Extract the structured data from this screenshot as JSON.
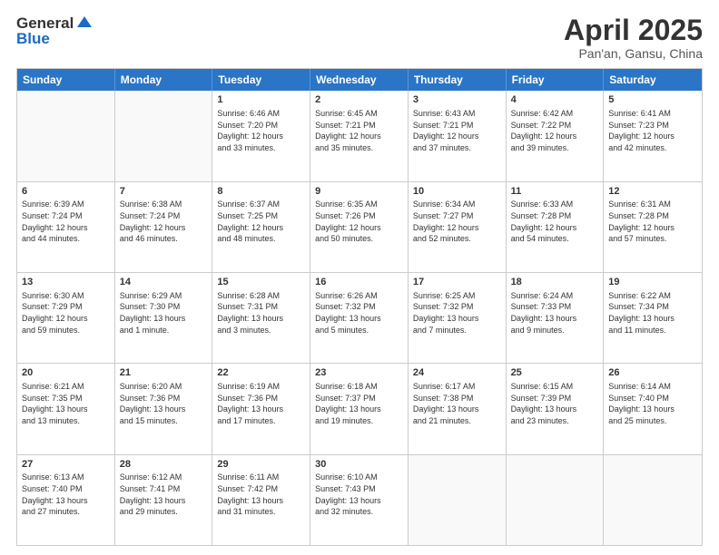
{
  "header": {
    "logo_general": "General",
    "logo_blue": "Blue",
    "title": "April 2025",
    "subtitle": "Pan'an, Gansu, China"
  },
  "calendar": {
    "days": [
      "Sunday",
      "Monday",
      "Tuesday",
      "Wednesday",
      "Thursday",
      "Friday",
      "Saturday"
    ],
    "rows": [
      [
        {
          "day": "",
          "text": ""
        },
        {
          "day": "",
          "text": ""
        },
        {
          "day": "1",
          "text": "Sunrise: 6:46 AM\nSunset: 7:20 PM\nDaylight: 12 hours\nand 33 minutes."
        },
        {
          "day": "2",
          "text": "Sunrise: 6:45 AM\nSunset: 7:21 PM\nDaylight: 12 hours\nand 35 minutes."
        },
        {
          "day": "3",
          "text": "Sunrise: 6:43 AM\nSunset: 7:21 PM\nDaylight: 12 hours\nand 37 minutes."
        },
        {
          "day": "4",
          "text": "Sunrise: 6:42 AM\nSunset: 7:22 PM\nDaylight: 12 hours\nand 39 minutes."
        },
        {
          "day": "5",
          "text": "Sunrise: 6:41 AM\nSunset: 7:23 PM\nDaylight: 12 hours\nand 42 minutes."
        }
      ],
      [
        {
          "day": "6",
          "text": "Sunrise: 6:39 AM\nSunset: 7:24 PM\nDaylight: 12 hours\nand 44 minutes."
        },
        {
          "day": "7",
          "text": "Sunrise: 6:38 AM\nSunset: 7:24 PM\nDaylight: 12 hours\nand 46 minutes."
        },
        {
          "day": "8",
          "text": "Sunrise: 6:37 AM\nSunset: 7:25 PM\nDaylight: 12 hours\nand 48 minutes."
        },
        {
          "day": "9",
          "text": "Sunrise: 6:35 AM\nSunset: 7:26 PM\nDaylight: 12 hours\nand 50 minutes."
        },
        {
          "day": "10",
          "text": "Sunrise: 6:34 AM\nSunset: 7:27 PM\nDaylight: 12 hours\nand 52 minutes."
        },
        {
          "day": "11",
          "text": "Sunrise: 6:33 AM\nSunset: 7:28 PM\nDaylight: 12 hours\nand 54 minutes."
        },
        {
          "day": "12",
          "text": "Sunrise: 6:31 AM\nSunset: 7:28 PM\nDaylight: 12 hours\nand 57 minutes."
        }
      ],
      [
        {
          "day": "13",
          "text": "Sunrise: 6:30 AM\nSunset: 7:29 PM\nDaylight: 12 hours\nand 59 minutes."
        },
        {
          "day": "14",
          "text": "Sunrise: 6:29 AM\nSunset: 7:30 PM\nDaylight: 13 hours\nand 1 minute."
        },
        {
          "day": "15",
          "text": "Sunrise: 6:28 AM\nSunset: 7:31 PM\nDaylight: 13 hours\nand 3 minutes."
        },
        {
          "day": "16",
          "text": "Sunrise: 6:26 AM\nSunset: 7:32 PM\nDaylight: 13 hours\nand 5 minutes."
        },
        {
          "day": "17",
          "text": "Sunrise: 6:25 AM\nSunset: 7:32 PM\nDaylight: 13 hours\nand 7 minutes."
        },
        {
          "day": "18",
          "text": "Sunrise: 6:24 AM\nSunset: 7:33 PM\nDaylight: 13 hours\nand 9 minutes."
        },
        {
          "day": "19",
          "text": "Sunrise: 6:22 AM\nSunset: 7:34 PM\nDaylight: 13 hours\nand 11 minutes."
        }
      ],
      [
        {
          "day": "20",
          "text": "Sunrise: 6:21 AM\nSunset: 7:35 PM\nDaylight: 13 hours\nand 13 minutes."
        },
        {
          "day": "21",
          "text": "Sunrise: 6:20 AM\nSunset: 7:36 PM\nDaylight: 13 hours\nand 15 minutes."
        },
        {
          "day": "22",
          "text": "Sunrise: 6:19 AM\nSunset: 7:36 PM\nDaylight: 13 hours\nand 17 minutes."
        },
        {
          "day": "23",
          "text": "Sunrise: 6:18 AM\nSunset: 7:37 PM\nDaylight: 13 hours\nand 19 minutes."
        },
        {
          "day": "24",
          "text": "Sunrise: 6:17 AM\nSunset: 7:38 PM\nDaylight: 13 hours\nand 21 minutes."
        },
        {
          "day": "25",
          "text": "Sunrise: 6:15 AM\nSunset: 7:39 PM\nDaylight: 13 hours\nand 23 minutes."
        },
        {
          "day": "26",
          "text": "Sunrise: 6:14 AM\nSunset: 7:40 PM\nDaylight: 13 hours\nand 25 minutes."
        }
      ],
      [
        {
          "day": "27",
          "text": "Sunrise: 6:13 AM\nSunset: 7:40 PM\nDaylight: 13 hours\nand 27 minutes."
        },
        {
          "day": "28",
          "text": "Sunrise: 6:12 AM\nSunset: 7:41 PM\nDaylight: 13 hours\nand 29 minutes."
        },
        {
          "day": "29",
          "text": "Sunrise: 6:11 AM\nSunset: 7:42 PM\nDaylight: 13 hours\nand 31 minutes."
        },
        {
          "day": "30",
          "text": "Sunrise: 6:10 AM\nSunset: 7:43 PM\nDaylight: 13 hours\nand 32 minutes."
        },
        {
          "day": "",
          "text": ""
        },
        {
          "day": "",
          "text": ""
        },
        {
          "day": "",
          "text": ""
        }
      ]
    ]
  }
}
